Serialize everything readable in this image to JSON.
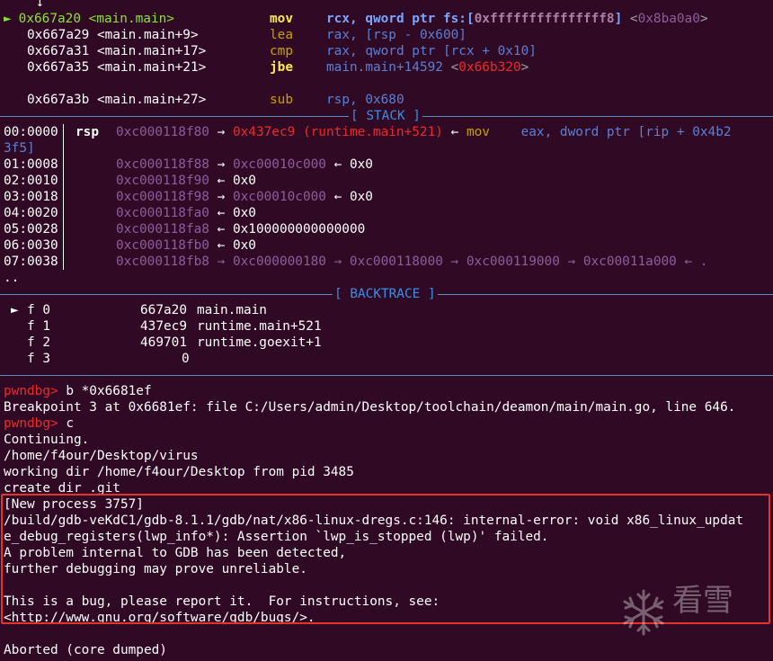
{
  "context_arrow": "↓",
  "disasm": [
    {
      "marker": "►",
      "addr": "0x667a20",
      "sym": "<main.main>",
      "op": "mov",
      "args_pre": "rcx, qword ptr fs:[",
      "args_hl": "0xfffffffffffffff8",
      "args_post": "]",
      "ref_open": " <",
      "ref": "0x8ba0a0",
      "ref_close": ">"
    },
    {
      "marker": "",
      "addr": "0x667a29",
      "sym": "<main.main+9>",
      "op": "lea",
      "args": "rax, [rsp - 0x600]"
    },
    {
      "marker": "",
      "addr": "0x667a31",
      "sym": "<main.main+17>",
      "op": "cmp",
      "args": "rax, qword ptr [rcx + 0x10]"
    },
    {
      "marker": "",
      "addr": "0x667a35",
      "sym": "<main.main+21>",
      "op": "jbe",
      "args": "main.main+14592",
      "ref_open": " <",
      "ref": "0x66b320",
      "ref_close": ">"
    },
    {
      "marker": "",
      "addr": "0x667a3b",
      "sym": "<main.main+27>",
      "op": "sub",
      "args": "rsp, 0x680"
    }
  ],
  "stack_label": "[ STACK ]",
  "stack": [
    {
      "off": "00:0000",
      "reg": "rsp",
      "addr": "0xc000118f80",
      "a1": "→",
      "v1": "0x437ec9 (runtime.main+521)",
      "a2": "←",
      "op": "mov",
      "ins": "eax, dword ptr [rip + 0x4b2",
      "wrap": "3f5]"
    },
    {
      "off": "01:0008",
      "addr": "0xc000118f88",
      "a1": "→",
      "v1": "0xc00010c000",
      "a2": "←",
      "v2": "0x0"
    },
    {
      "off": "02:0010",
      "addr": "0xc000118f90",
      "a1": "←",
      "v1": "0x0"
    },
    {
      "off": "03:0018",
      "addr": "0xc000118f98",
      "a1": "→",
      "v1": "0xc00010c000",
      "a2": "←",
      "v2": "0x0"
    },
    {
      "off": "04:0020",
      "addr": "0xc000118fa0",
      "a1": "←",
      "v1": "0x0"
    },
    {
      "off": "05:0028",
      "addr": "0xc000118fa8",
      "a1": "←",
      "v1": "0x100000000000000"
    },
    {
      "off": "06:0030",
      "addr": "0xc000118fb0",
      "a1": "←",
      "v1": "0x0"
    },
    {
      "off": "07:0038",
      "addr": "0xc000118fb8",
      "chain": "→ 0xc000000180 → 0xc000118000 → 0xc000119000 → 0xc00011a000 ← .",
      "wrap": ".."
    }
  ],
  "backtrace_label": "[ BACKTRACE ]",
  "backtrace": [
    {
      "marker": "►",
      "frame": "f 0",
      "addr": "667a20",
      "sym": "main.main"
    },
    {
      "marker": "",
      "frame": "f 1",
      "addr": "437ec9",
      "sym": "runtime.main+521"
    },
    {
      "marker": "",
      "frame": "f 2",
      "addr": "469701",
      "sym": "runtime.goexit+1"
    },
    {
      "marker": "",
      "frame": "f 3",
      "addr": "0",
      "sym": ""
    }
  ],
  "prompt": "pwndbg>",
  "cmd1": " b *0x6681ef",
  "out1": "Breakpoint 3 at 0x6681ef: file C:/Users/admin/Desktop/toolchain/deamon/main/main.go, line 646.",
  "cmd2": " c",
  "out2": [
    "Continuing.",
    "/home/f4our/Desktop/virus",
    "working dir /home/f4our/Desktop from pid 3485",
    "create dir .git"
  ],
  "error_lines": [
    "[New process 3757]",
    "/build/gdb-veKdC1/gdb-8.1.1/gdb/nat/x86-linux-dregs.c:146: internal-error: void x86_linux_updat",
    "e_debug_registers(lwp_info*): Assertion `lwp_is_stopped (lwp)' failed.",
    "A problem internal to GDB has been detected,",
    "further debugging may prove unreliable.",
    "",
    "This is a bug, please report it.  For instructions, see:",
    "<http://www.gnu.org/software/gdb/bugs/>."
  ],
  "final": "Aborted (core dumped)",
  "watermark": "看雪",
  "colors": {
    "background": "#300a24",
    "highlight": "#e5322d",
    "section_rule": "#3a8ee6"
  }
}
